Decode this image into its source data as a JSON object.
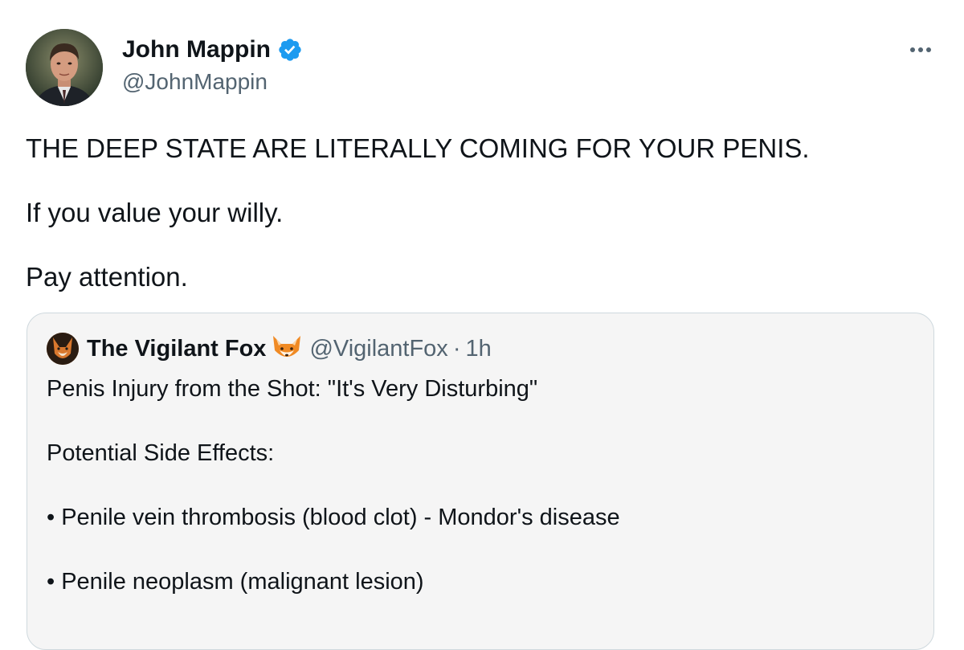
{
  "tweet": {
    "author": {
      "name": "John Mappin",
      "handle": "@JohnMappin",
      "verified": true,
      "avatar_icon": "profile-photo"
    },
    "more_icon": "more-options-icon",
    "text_lines": [
      "THE DEEP STATE ARE LITERALLY COMING FOR YOUR PENIS.",
      "If you value your willy.",
      "Pay attention."
    ]
  },
  "quoted_tweet": {
    "author": {
      "name": "The Vigilant Fox",
      "emoji_icon": "fox-face-icon",
      "handle": "@VigilantFox",
      "separator": "·",
      "time": "1h"
    },
    "text_lines": [
      "Penis Injury from the Shot: \"It's Very Disturbing\"",
      "Potential Side Effects:",
      "• Penile vein thrombosis (blood clot) - Mondor's disease",
      "• Penile neoplasm (malignant lesion)"
    ]
  },
  "colors": {
    "text_primary": "#0f1419",
    "text_secondary": "#536471",
    "verified_blue": "#1d9bf0",
    "quote_border": "#cfd9de",
    "quote_background": "#f5f5f5"
  }
}
